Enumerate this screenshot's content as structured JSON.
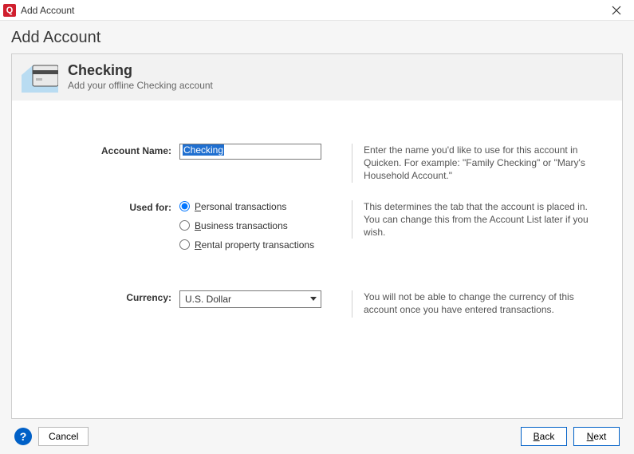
{
  "window": {
    "title": "Add Account",
    "app_icon_letter": "Q"
  },
  "page": {
    "heading": "Add Account"
  },
  "account_header": {
    "title": "Checking",
    "subtitle": "Add your offline Checking account"
  },
  "form": {
    "account_name": {
      "label": "Account Name:",
      "value": "Checking",
      "helper": "Enter the name you'd like to use for this account in Quicken. For example: \"Family Checking\" or \"Mary's Household Account.\""
    },
    "used_for": {
      "label": "Used for:",
      "options": [
        {
          "label": "Personal transactions",
          "mnemonic": "P",
          "checked": true
        },
        {
          "label": "Business transactions",
          "mnemonic": "B",
          "checked": false
        },
        {
          "label": "Rental property transactions",
          "mnemonic": "R",
          "checked": false
        }
      ],
      "helper": "This determines the tab that the account is placed in. You can change this from the Account List later if you wish."
    },
    "currency": {
      "label": "Currency:",
      "value": "U.S. Dollar",
      "helper": "You will not be able to change the currency of this account once you have entered transactions."
    }
  },
  "footer": {
    "help_symbol": "?",
    "cancel": "Cancel",
    "back": "Back",
    "back_mnemonic": "B",
    "next": "Next",
    "next_mnemonic": "N"
  }
}
